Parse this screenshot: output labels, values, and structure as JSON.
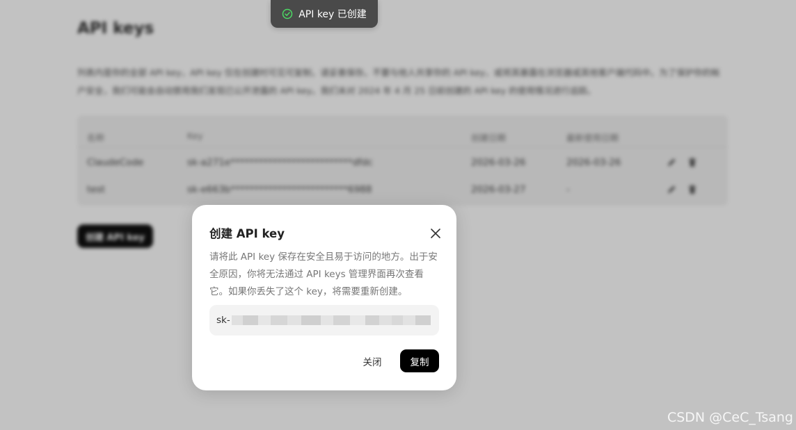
{
  "page": {
    "title": "API keys",
    "description": "列表内是你的全部 API key，API key 仅在创建时可见可复制，请妥善保存。不要与他人共享你的 API key，或将其暴露在浏览器或其他客户端代码中。为了保护你的帐户安全，我们可能会自动禁用我们发现已公开泄露的 API key。我们未对 2024 年 4 月 25 日前创建的 API key 的使用情况进行追踪。",
    "table": {
      "headers": [
        "名称",
        "Key",
        "创建日期",
        "最新使用日期"
      ],
      "rows": [
        {
          "name": "ClaudeCode",
          "key": "sk-a271e**************************dfdc",
          "created": "2026-03-26",
          "last_used": "2026-03-26"
        },
        {
          "name": "test",
          "key": "sk-e663b*************************6988",
          "created": "2026-03-27",
          "last_used": "-"
        }
      ]
    },
    "create_button": "创建 API key"
  },
  "toast": {
    "text": "API key 已创建",
    "icon": "check-circle-icon",
    "icon_color": "#4cd964"
  },
  "modal": {
    "title": "创建 API key",
    "body": "请将此 API key 保存在安全且易于访问的地方。出于安全原因，你将无法通过 API keys 管理界面再次查看它。如果你丢失了这个 key，将需要重新创建。",
    "key_prefix": "sk-",
    "close_label": "关闭",
    "copy_label": "复制",
    "close_icon": "close-icon"
  },
  "watermark": "CSDN @CeC_Tsang",
  "colors": {
    "accent": "#000000",
    "overlay": "rgba(0,0,0,0.24)",
    "toast_bg": "#4a4a4a"
  }
}
